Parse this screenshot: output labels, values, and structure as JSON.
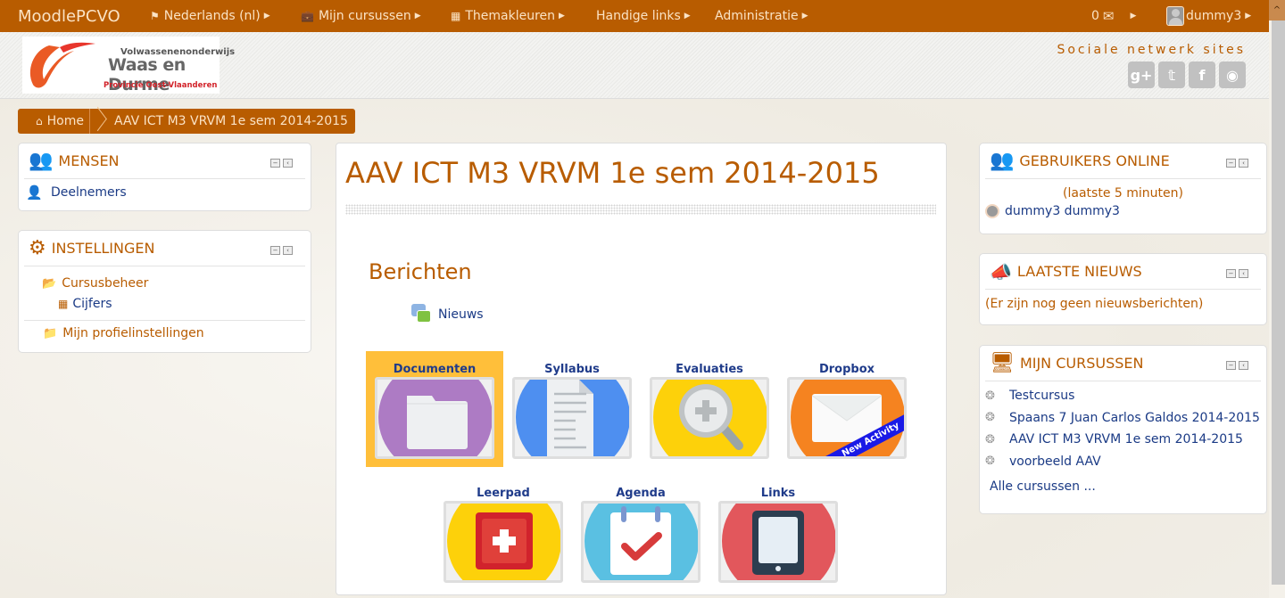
{
  "navbar": {
    "brand": "MoodlePCVO",
    "items": [
      {
        "label": "Nederlands (nl)",
        "icon": "flag-icon"
      },
      {
        "label": "Mijn cursussen",
        "icon": "briefcase-icon"
      },
      {
        "label": "Themakleuren",
        "icon": "grid-icon"
      },
      {
        "label": "Handige links",
        "icon": ""
      },
      {
        "label": "Administratie",
        "icon": ""
      }
    ],
    "messages_count": "0",
    "user_name": "dummy3"
  },
  "header": {
    "logo": {
      "line1": "Volwassenenonderwijs",
      "line2": "Waas en Durme",
      "line3": "Provincie Oost-Vlaanderen"
    },
    "social_title": "Sociale netwerk sites",
    "social_icons": [
      "google-plus-icon",
      "twitter-icon",
      "facebook-icon",
      "dribbble-icon"
    ]
  },
  "breadcrumb": {
    "home": "Home",
    "current": "AAV ICT M3 VRVM 1e sem 2014-2015"
  },
  "left_blocks": {
    "mensen": {
      "title": "MENSEN",
      "items": [
        "Deelnemers"
      ]
    },
    "instellingen": {
      "title": "INSTELLINGEN",
      "cursusbeheer": "Cursusbeheer",
      "cijfers": "Cijfers",
      "profiel": "Mijn profielinstellingen"
    }
  },
  "main": {
    "title": "AAV ICT M3 VRVM 1e sem 2014-2015",
    "section_title": "Berichten",
    "news_link": "Nieuws",
    "tiles": [
      {
        "label": "Documenten",
        "color": "#ad7bc4",
        "active": true
      },
      {
        "label": "Syllabus",
        "color": "#4e8ff0",
        "active": false
      },
      {
        "label": "Evaluaties",
        "color": "#fdd10a",
        "active": false
      },
      {
        "label": "Dropbox",
        "color": "#f58320",
        "active": false,
        "badge": "New Activity"
      },
      {
        "label": "Leerpad",
        "color": "#fdd10a",
        "active": false
      },
      {
        "label": "Agenda",
        "color": "#5ac0e2",
        "active": false
      },
      {
        "label": "Links",
        "color": "#e2575c",
        "active": false
      }
    ]
  },
  "right_blocks": {
    "online": {
      "title": "GEBRUIKERS ONLINE",
      "subtitle": "(laatste 5 minuten)",
      "users": [
        "dummy3 dummy3"
      ]
    },
    "news": {
      "title": "LAATSTE NIEUWS",
      "empty_text": "(Er zijn nog geen nieuwsberichten)"
    },
    "courses": {
      "title": "MIJN CURSUSSEN",
      "items": [
        "Testcursus",
        "Spaans 7 Juan Carlos Galdos 2014-2015",
        "AAV ICT M3 VRVM 1e sem 2014-2015",
        "voorbeeld AAV"
      ],
      "all_link": "Alle cursussen ..."
    }
  },
  "colors": {
    "accent": "#b85c00",
    "link": "#1a3a85",
    "active_tile": "#ffbf3a"
  }
}
